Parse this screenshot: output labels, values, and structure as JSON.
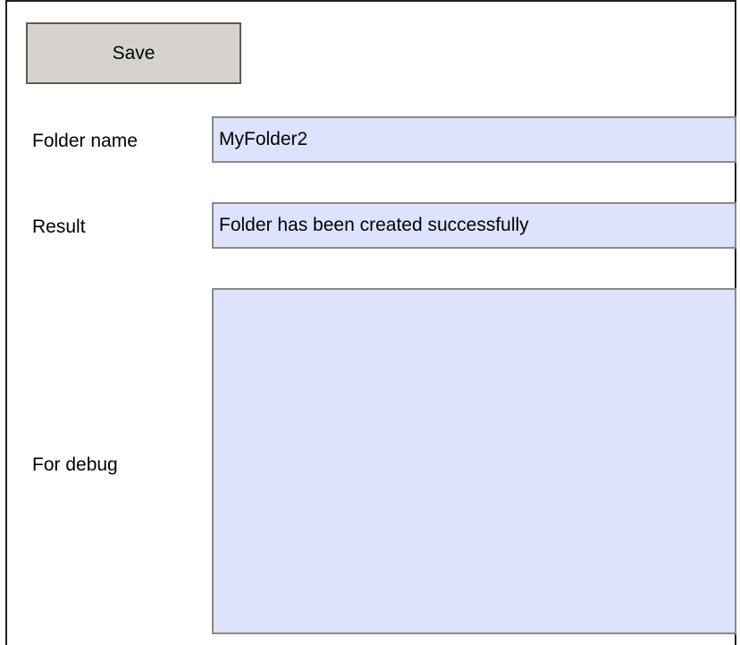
{
  "toolbar": {
    "save_label": "Save"
  },
  "form": {
    "folder_name_label": "Folder name",
    "folder_name_value": "MyFolder2",
    "result_label": "Result",
    "result_value": "Folder has been created successfully",
    "debug_label": "For debug",
    "debug_value": ""
  },
  "colors": {
    "field_background": "#dde3fd",
    "button_background": "#d6d3ce"
  }
}
